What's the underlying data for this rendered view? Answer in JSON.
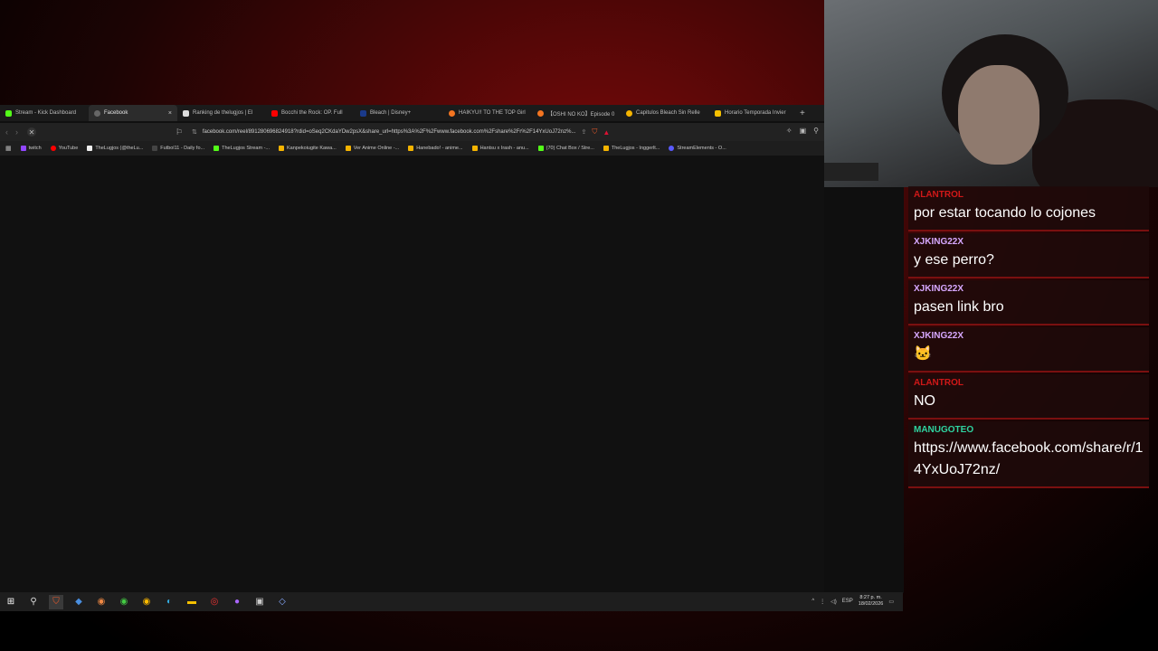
{
  "browser": {
    "tabs": [
      {
        "label": "Stream - Kick Dashboard",
        "icon": "kick-icon",
        "color": "#53fc18"
      },
      {
        "label": "Facebook",
        "icon": "loading-icon",
        "color": "#888888",
        "active": true
      },
      {
        "label": "Ranking de thelugjos | El",
        "icon": "site-icon",
        "color": "#dddddd"
      },
      {
        "label": "Bocchi the Rock: OP. Full",
        "icon": "youtube-icon",
        "color": "#ff0000"
      },
      {
        "label": "Bleach | Disney+",
        "icon": "disney-icon",
        "color": "#1a3a8a"
      },
      {
        "label": "HAIKYU!! TO THE TOP Girl",
        "icon": "crunchyroll-icon",
        "color": "#f47521"
      },
      {
        "label": "【OSHI NO KO】Episode 0",
        "icon": "crunchyroll-icon",
        "color": "#f47521"
      },
      {
        "label": "Capitulos Bleach Sin Relle",
        "icon": "site-icon",
        "color": "#f5b400"
      },
      {
        "label": "Horario Temporada Invier",
        "icon": "site-icon",
        "color": "#f5c000"
      }
    ],
    "close_glyph": "×",
    "new_tab_glyph": "+",
    "url": "facebook.com/reel/891280696824918?rdid=oSeq2CKdaYDw2psX&share_url=https%3A%2F%2Fwww.facebook.com%2Fshare%2Fr%2F14YxUoJ72nz%...",
    "bookmarks": [
      {
        "label": "twitch",
        "color": "#9146ff"
      },
      {
        "label": "YouTube",
        "color": "#ff0000"
      },
      {
        "label": "TheLugjos (@theLu...",
        "color": "#ffffff"
      },
      {
        "label": "Futbol11 - Daily fo...",
        "color": "#333333"
      },
      {
        "label": "TheLugjos Stream -...",
        "color": "#53fc18"
      },
      {
        "label": "Kanpekoiugite Kawa...",
        "color": "#f5b400"
      },
      {
        "label": "Ver Anime Online -...",
        "color": "#f5b400"
      },
      {
        "label": "Hanebado! - anime...",
        "color": "#f5b400"
      },
      {
        "label": "Hantsu x Irash - anu...",
        "color": "#f5b400"
      },
      {
        "label": "(70) Chat Box / Stre...",
        "color": "#53fc18"
      },
      {
        "label": "TheLugjos - Inggerlt...",
        "color": "#f5b400"
      },
      {
        "label": "StreamElements - O...",
        "color": "#5a5aff"
      }
    ]
  },
  "taskbar": {
    "lang": "ESP",
    "time": "8:27 p. m.",
    "date": "18/02/2026"
  },
  "chat": {
    "messages": [
      {
        "user": "ALANTROL",
        "user_color": "#d01818",
        "text": "por estar tocando lo cojones"
      },
      {
        "user": "XJKING22X",
        "user_color": "#d7a8ff",
        "text": "y ese perro?"
      },
      {
        "user": "XJKING22X",
        "user_color": "#d7a8ff",
        "text": "pasen link bro"
      },
      {
        "user": "XJKING22X",
        "user_color": "#d7a8ff",
        "text": "🐱"
      },
      {
        "user": "ALANTROL",
        "user_color": "#d01818",
        "text": "NO"
      },
      {
        "user": "MANUGOTEO",
        "user_color": "#2fd3a0",
        "text": "https://www.facebook.com/share/r/14YxUoJ72nz/"
      }
    ]
  }
}
